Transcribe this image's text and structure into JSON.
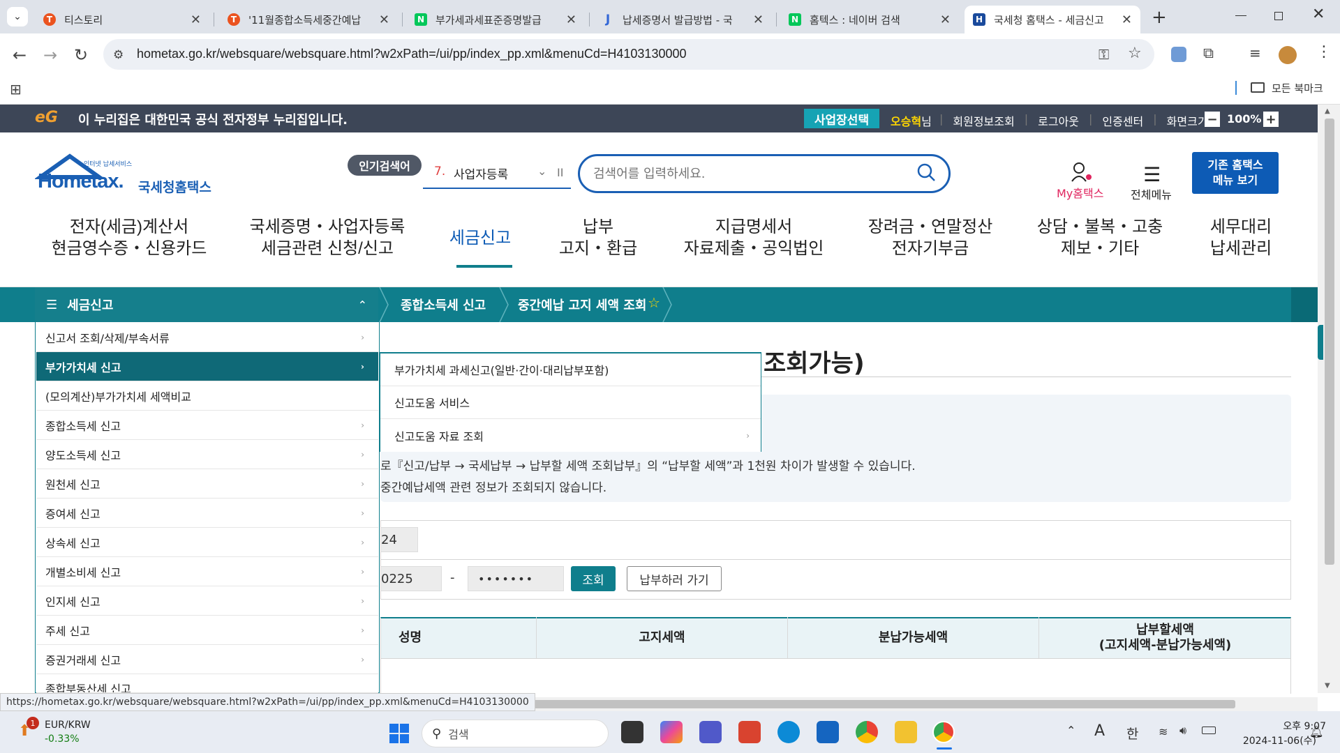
{
  "browser": {
    "tabs": [
      {
        "title": "티스토리",
        "favicon_color": "#eb531f",
        "fav_letter": "T"
      },
      {
        "title": "'11월종합소득세중간예납",
        "favicon_color": "#eb531f",
        "fav_letter": "T"
      },
      {
        "title": "부가세과세표준증명발급",
        "favicon_color": "#03c75a",
        "fav_letter": "N"
      },
      {
        "title": "납세증명서 발급방법 - 국",
        "favicon_color": "#3367d6",
        "fav_letter": "J"
      },
      {
        "title": "홈텍스 : 네이버 검색",
        "favicon_color": "#03c75a",
        "fav_letter": "N"
      },
      {
        "title": "국세청 홈택스 - 세금신고",
        "favicon_color": "#1a4a9c",
        "fav_letter": "H"
      }
    ],
    "new_tab": "+",
    "url": "hometax.go.kr/websquare/websquare.html?w2xPath=/ui/pp/index_pp.xml&menuCd=H4103130000",
    "bookmarks_label": "모든 북마크",
    "status_url": "https://hometax.go.kr/websquare/websquare.html?w2xPath=/ui/pp/index_pp.xml&menuCd=H4103130000"
  },
  "govbar": {
    "logo": "eG",
    "notice": "이 누리집은 대한민국 공식 전자정부 누리집입니다.",
    "biz_select": "사업장선택",
    "user_name": "오승혁",
    "user_suffix": "님",
    "links": [
      "회원정보조회",
      "로그아웃",
      "인증센터",
      "화면크기"
    ],
    "zoom": "100%",
    "zoom_minus": "−",
    "zoom_plus": "+"
  },
  "header": {
    "logo_small": "인터넷 납세서비스",
    "logo_main": "Hometax.",
    "logo_sub": "국세청홈택스",
    "popular_label": "인기검색어",
    "popular_rank": "7.",
    "popular_term": "사업자등록",
    "search_placeholder": "검색어를 입력하세요.",
    "my_label": "My홈택스",
    "all_menu": "전체메뉴",
    "old_menu": "기존 홈택스\n메뉴 보기"
  },
  "gnb": [
    "전자(세금)계산서\n현금영수증・신용카드",
    "국세증명・사업자등록\n세금관련 신청/신고",
    "세금신고",
    "납부\n고지・환급",
    "지급명세서\n자료제출・공익법인",
    "장려금・연말정산\n전자기부금",
    "상담・불복・고충\n제보・기타",
    "세무대리\n납세관리"
  ],
  "lnb": {
    "menu_title": "세금신고",
    "crumbs": [
      "종합소득세 신고",
      "중간예납 고지 세액 조회"
    ]
  },
  "left_menu": [
    "신고서 조회/삭제/부속서류",
    "부가가치세 신고",
    "(모의계산)부가가치세 세액비교",
    "종합소득세 신고",
    "양도소득세 신고",
    "원천세 신고",
    "증여세 신고",
    "상속세 신고",
    "개별소비세 신고",
    "인지세 신고",
    "주세 신고",
    "증권거래세 신고",
    "종합부동산세 신고"
  ],
  "sub_menu": [
    "부가가치세 과세신고(일반·간이·대리납부포함)",
    "신고도움 서비스",
    "신고도움 자료 조회"
  ],
  "page": {
    "title_fragment": "조회가능)",
    "notice1": "로『신고/납부 → 국세납부 → 납부할 세액 조회납부』의 “납부할 세액”과 1천원 차이가 발생할 수 있습니다.",
    "notice2": " 중간예납세액 관련 정보가 조회되지 않습니다.",
    "year_value": "24",
    "id_front": "0225",
    "id_dash": "-",
    "id_back": "•••••••",
    "search_btn": "조회",
    "pay_btn": "납부하러 가기",
    "table_headers": [
      "성명",
      "고지세액",
      "분납가능세액",
      "납부할세액\n(고지세액-분납가능세액)"
    ]
  },
  "taskbar": {
    "widget_badge": "1",
    "widget_title": "EUR/KRW",
    "widget_value": "-0.33%",
    "search_placeholder": "검색",
    "ime_a": "A",
    "ime_han": "한",
    "time": "오후 9:07",
    "date": "2024-11-06(수)"
  }
}
